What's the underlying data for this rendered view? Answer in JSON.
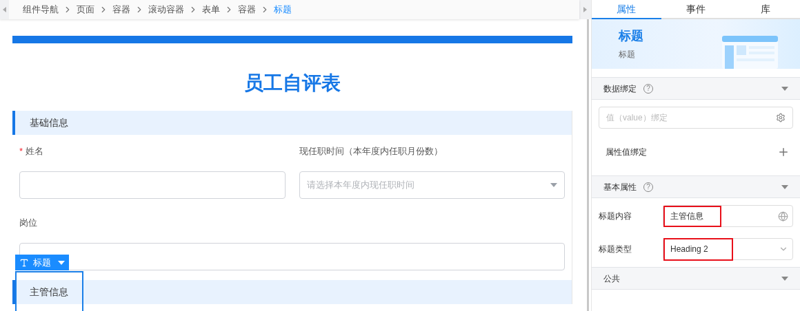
{
  "breadcrumb": [
    {
      "label": "组件导航",
      "selected": false
    },
    {
      "label": "页面",
      "selected": false
    },
    {
      "label": "容器",
      "selected": false
    },
    {
      "label": "滚动容器",
      "selected": false
    },
    {
      "label": "表单",
      "selected": false
    },
    {
      "label": "容器",
      "selected": false
    },
    {
      "label": "标题",
      "selected": true
    }
  ],
  "form": {
    "title": "员工自评表",
    "sections": [
      {
        "title": "基础信息",
        "selected": false
      },
      {
        "title": "主管信息",
        "selected": true
      }
    ],
    "fields": [
      {
        "label": "姓名",
        "required_mark": "*",
        "kind": "input"
      },
      {
        "label": "现任职时间（本年度内任职月份数）",
        "kind": "select",
        "placeholder": "请选择本年度内现任职时间"
      },
      {
        "label": "岗位",
        "kind": "input"
      }
    ],
    "selection_toolbar": {
      "label": "标题"
    }
  },
  "panel": {
    "tabs": [
      {
        "label": "属性",
        "selected": true
      },
      {
        "label": "事件",
        "selected": false
      },
      {
        "label": "库",
        "selected": false
      }
    ],
    "header": {
      "title": "标题",
      "subtitle": "标题"
    },
    "groups": [
      {
        "title": "数据绑定",
        "help": "?",
        "rows": [
          {
            "kind": "binding",
            "placeholder": "值（value）绑定"
          },
          {
            "kind": "add",
            "label": "属性值绑定"
          }
        ]
      },
      {
        "title": "基本属性",
        "help": "?",
        "rows": [
          {
            "kind": "text",
            "label": "标题内容",
            "value": "主管信息",
            "highlighted": true
          },
          {
            "kind": "select",
            "label": "标题类型",
            "value": "Heading 2",
            "highlighted": true
          }
        ]
      },
      {
        "title": "公共"
      }
    ]
  }
}
